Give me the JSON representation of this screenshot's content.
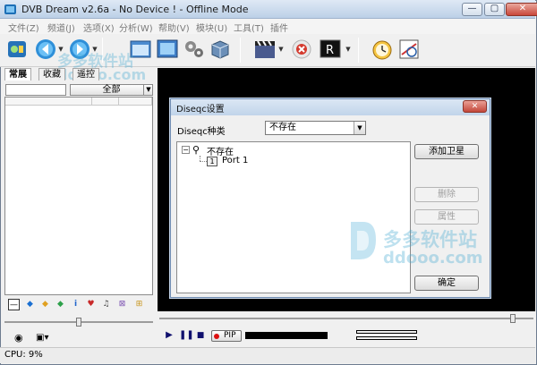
{
  "window": {
    "title": "DVB Dream v2.6a - No Device ! - Offline Mode",
    "minimize_glyph": "—",
    "maximize_glyph": "▢",
    "close_glyph": "✕"
  },
  "menu": {
    "items": [
      "文件(Z)",
      "频道(J)",
      "选项(X)",
      "分析(W)",
      "帮助(V)",
      "模块(U)",
      "工具(T)",
      "插件"
    ]
  },
  "toolbar": {
    "icons": [
      "dvb-logo-icon",
      "back-icon",
      "forward-icon",
      "window-icon",
      "screenshot-icon",
      "settings-gears-icon",
      "cube-icon",
      "clapper-icon",
      "record-stop-icon",
      "r-monitor-icon",
      "clock-icon",
      "calendar-icon"
    ]
  },
  "watermark": {
    "text_cn": "多多软件站",
    "text_en": "ddooo.com"
  },
  "left_panel": {
    "tabs": [
      "常展",
      "收藏",
      "遥控"
    ],
    "group_select": "全部",
    "filter_icons": [
      "—",
      "◆",
      "◆",
      "◆",
      "i",
      "♥",
      "♫",
      "⊠",
      "⊞"
    ]
  },
  "dialog": {
    "title": "Diseqc设置",
    "close_glyph": "✕",
    "type_label": "Diseqc种类",
    "type_value": "不存在",
    "tree": {
      "root": "不存在",
      "child_index": "1",
      "child": "Port 1"
    },
    "buttons": {
      "add_satellite": "添加卫星",
      "delete": "删除",
      "properties": "属性",
      "ok": "确定"
    }
  },
  "playback": {
    "pip_label": "PIP"
  },
  "status": {
    "cpu": "CPU: 9%"
  }
}
